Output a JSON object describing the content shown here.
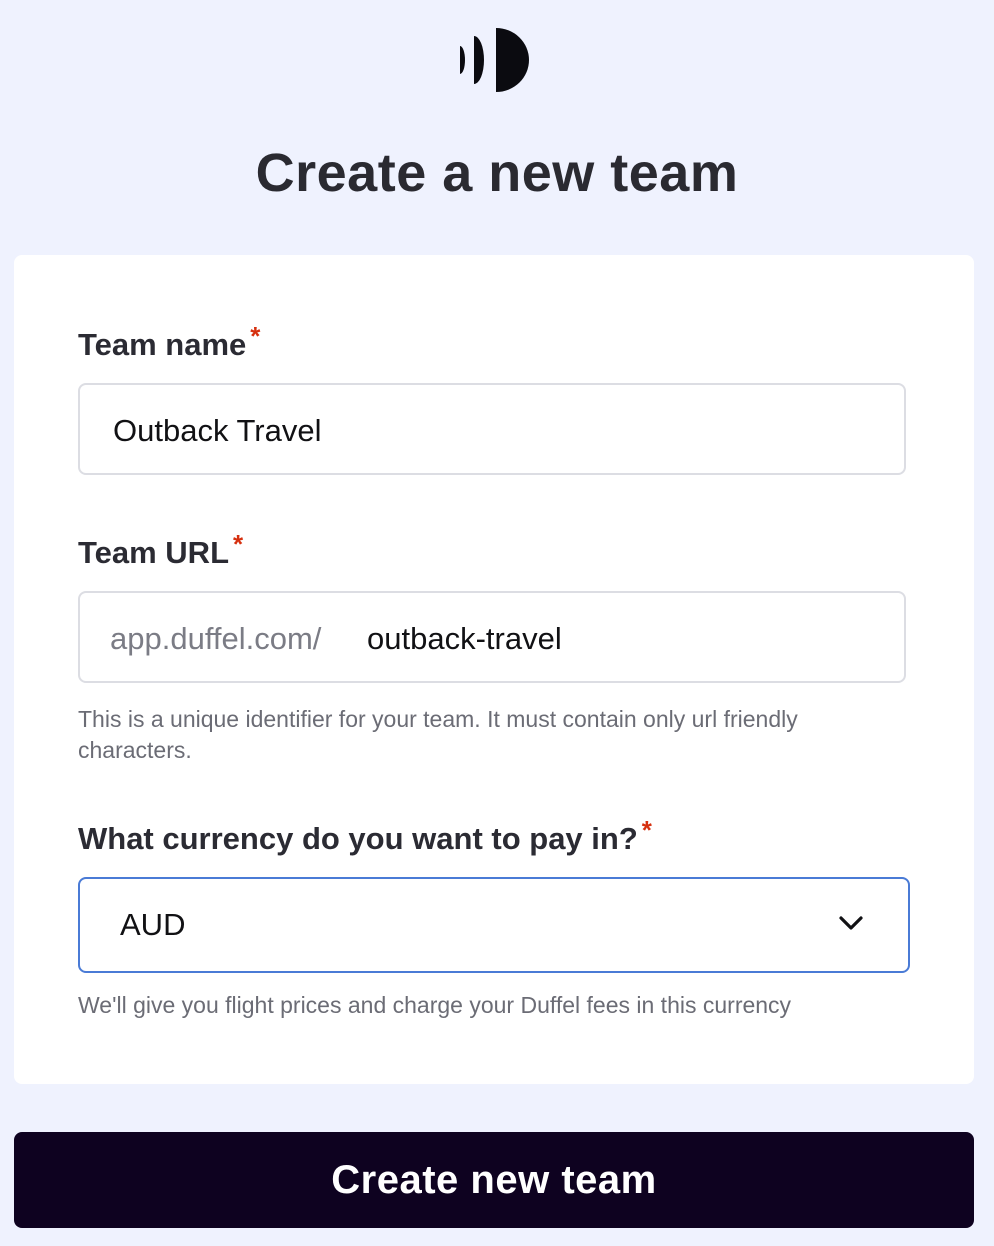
{
  "header": {
    "logo_icon": "duffel-logo-icon",
    "title": "Create a new team"
  },
  "form": {
    "team_name": {
      "label": "Team name",
      "required_marker": "*",
      "value": "Outback Travel"
    },
    "team_url": {
      "label": "Team URL",
      "required_marker": "*",
      "prefix": "app.duffel.com/",
      "value": "outback-travel",
      "helper": "This is a unique identifier for your team. It must contain only url friendly characters."
    },
    "currency": {
      "label": "What currency do you want to pay in?",
      "required_marker": "*",
      "selected": "AUD",
      "icon": "chevron-down-icon",
      "helper": "We'll give you flight prices and charge your Duffel fees in this currency"
    }
  },
  "actions": {
    "submit_label": "Create new team"
  },
  "colors": {
    "page_background": "#eff2fe",
    "card_background": "#ffffff",
    "required": "#d6300f",
    "focus_border": "#4a7bd6",
    "button_background": "#0e0220",
    "button_text": "#ffffff"
  }
}
